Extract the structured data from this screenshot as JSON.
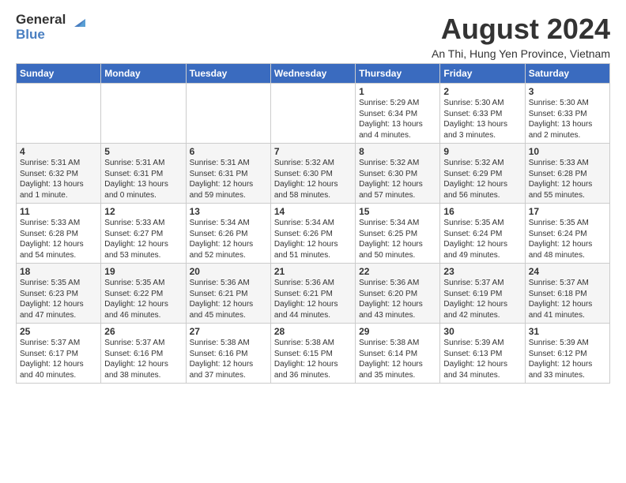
{
  "header": {
    "logo_line1": "General",
    "logo_line2": "Blue",
    "month_title": "August 2024",
    "subtitle": "An Thi, Hung Yen Province, Vietnam"
  },
  "weekdays": [
    "Sunday",
    "Monday",
    "Tuesday",
    "Wednesday",
    "Thursday",
    "Friday",
    "Saturday"
  ],
  "weeks": [
    [
      {
        "day": "",
        "info": ""
      },
      {
        "day": "",
        "info": ""
      },
      {
        "day": "",
        "info": ""
      },
      {
        "day": "",
        "info": ""
      },
      {
        "day": "1",
        "info": "Sunrise: 5:29 AM\nSunset: 6:34 PM\nDaylight: 13 hours\nand 4 minutes."
      },
      {
        "day": "2",
        "info": "Sunrise: 5:30 AM\nSunset: 6:33 PM\nDaylight: 13 hours\nand 3 minutes."
      },
      {
        "day": "3",
        "info": "Sunrise: 5:30 AM\nSunset: 6:33 PM\nDaylight: 13 hours\nand 2 minutes."
      }
    ],
    [
      {
        "day": "4",
        "info": "Sunrise: 5:31 AM\nSunset: 6:32 PM\nDaylight: 13 hours\nand 1 minute."
      },
      {
        "day": "5",
        "info": "Sunrise: 5:31 AM\nSunset: 6:31 PM\nDaylight: 13 hours\nand 0 minutes."
      },
      {
        "day": "6",
        "info": "Sunrise: 5:31 AM\nSunset: 6:31 PM\nDaylight: 12 hours\nand 59 minutes."
      },
      {
        "day": "7",
        "info": "Sunrise: 5:32 AM\nSunset: 6:30 PM\nDaylight: 12 hours\nand 58 minutes."
      },
      {
        "day": "8",
        "info": "Sunrise: 5:32 AM\nSunset: 6:30 PM\nDaylight: 12 hours\nand 57 minutes."
      },
      {
        "day": "9",
        "info": "Sunrise: 5:32 AM\nSunset: 6:29 PM\nDaylight: 12 hours\nand 56 minutes."
      },
      {
        "day": "10",
        "info": "Sunrise: 5:33 AM\nSunset: 6:28 PM\nDaylight: 12 hours\nand 55 minutes."
      }
    ],
    [
      {
        "day": "11",
        "info": "Sunrise: 5:33 AM\nSunset: 6:28 PM\nDaylight: 12 hours\nand 54 minutes."
      },
      {
        "day": "12",
        "info": "Sunrise: 5:33 AM\nSunset: 6:27 PM\nDaylight: 12 hours\nand 53 minutes."
      },
      {
        "day": "13",
        "info": "Sunrise: 5:34 AM\nSunset: 6:26 PM\nDaylight: 12 hours\nand 52 minutes."
      },
      {
        "day": "14",
        "info": "Sunrise: 5:34 AM\nSunset: 6:26 PM\nDaylight: 12 hours\nand 51 minutes."
      },
      {
        "day": "15",
        "info": "Sunrise: 5:34 AM\nSunset: 6:25 PM\nDaylight: 12 hours\nand 50 minutes."
      },
      {
        "day": "16",
        "info": "Sunrise: 5:35 AM\nSunset: 6:24 PM\nDaylight: 12 hours\nand 49 minutes."
      },
      {
        "day": "17",
        "info": "Sunrise: 5:35 AM\nSunset: 6:24 PM\nDaylight: 12 hours\nand 48 minutes."
      }
    ],
    [
      {
        "day": "18",
        "info": "Sunrise: 5:35 AM\nSunset: 6:23 PM\nDaylight: 12 hours\nand 47 minutes."
      },
      {
        "day": "19",
        "info": "Sunrise: 5:35 AM\nSunset: 6:22 PM\nDaylight: 12 hours\nand 46 minutes."
      },
      {
        "day": "20",
        "info": "Sunrise: 5:36 AM\nSunset: 6:21 PM\nDaylight: 12 hours\nand 45 minutes."
      },
      {
        "day": "21",
        "info": "Sunrise: 5:36 AM\nSunset: 6:21 PM\nDaylight: 12 hours\nand 44 minutes."
      },
      {
        "day": "22",
        "info": "Sunrise: 5:36 AM\nSunset: 6:20 PM\nDaylight: 12 hours\nand 43 minutes."
      },
      {
        "day": "23",
        "info": "Sunrise: 5:37 AM\nSunset: 6:19 PM\nDaylight: 12 hours\nand 42 minutes."
      },
      {
        "day": "24",
        "info": "Sunrise: 5:37 AM\nSunset: 6:18 PM\nDaylight: 12 hours\nand 41 minutes."
      }
    ],
    [
      {
        "day": "25",
        "info": "Sunrise: 5:37 AM\nSunset: 6:17 PM\nDaylight: 12 hours\nand 40 minutes."
      },
      {
        "day": "26",
        "info": "Sunrise: 5:37 AM\nSunset: 6:16 PM\nDaylight: 12 hours\nand 38 minutes."
      },
      {
        "day": "27",
        "info": "Sunrise: 5:38 AM\nSunset: 6:16 PM\nDaylight: 12 hours\nand 37 minutes."
      },
      {
        "day": "28",
        "info": "Sunrise: 5:38 AM\nSunset: 6:15 PM\nDaylight: 12 hours\nand 36 minutes."
      },
      {
        "day": "29",
        "info": "Sunrise: 5:38 AM\nSunset: 6:14 PM\nDaylight: 12 hours\nand 35 minutes."
      },
      {
        "day": "30",
        "info": "Sunrise: 5:39 AM\nSunset: 6:13 PM\nDaylight: 12 hours\nand 34 minutes."
      },
      {
        "day": "31",
        "info": "Sunrise: 5:39 AM\nSunset: 6:12 PM\nDaylight: 12 hours\nand 33 minutes."
      }
    ]
  ]
}
